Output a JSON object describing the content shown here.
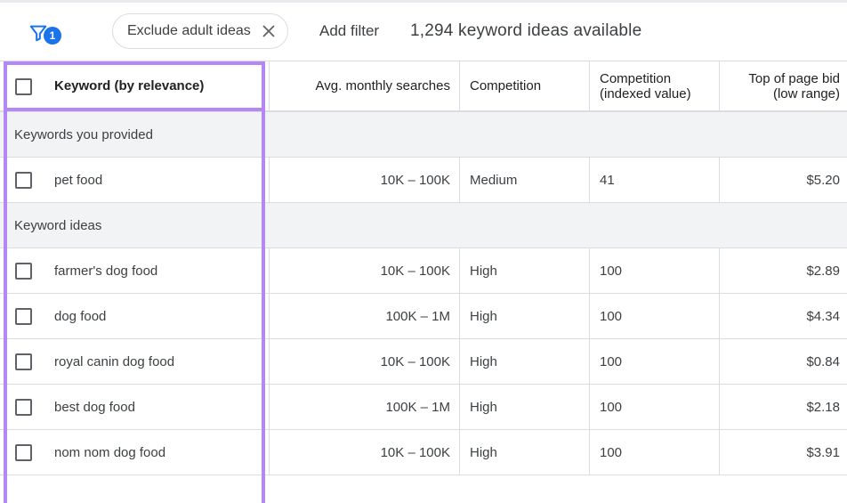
{
  "toolbar": {
    "filter_count": "1",
    "chip_label": "Exclude adult ideas",
    "add_filter": "Add filter",
    "ideas_count": "1,294 keyword ideas available"
  },
  "table": {
    "headers": {
      "keyword": "Keyword (by relevance)",
      "avg": "Avg. monthly searches",
      "competition": "Competition",
      "indexed_line1": "Competition",
      "indexed_line2": "(indexed value)",
      "bid_line1": "Top of page bid",
      "bid_line2": "(low range)"
    },
    "groups": {
      "provided": "Keywords you provided",
      "ideas": "Keyword ideas"
    },
    "provided_rows": [
      {
        "keyword": "pet food",
        "avg": "10K – 100K",
        "competition": "Medium",
        "indexed": "41",
        "bid": "$5.20"
      }
    ],
    "idea_rows": [
      {
        "keyword": "farmer's dog food",
        "avg": "10K – 100K",
        "competition": "High",
        "indexed": "100",
        "bid": "$2.89"
      },
      {
        "keyword": "dog food",
        "avg": "100K – 1M",
        "competition": "High",
        "indexed": "100",
        "bid": "$4.34"
      },
      {
        "keyword": "royal canin dog food",
        "avg": "10K – 100K",
        "competition": "High",
        "indexed": "100",
        "bid": "$0.84"
      },
      {
        "keyword": "best dog food",
        "avg": "100K – 1M",
        "competition": "High",
        "indexed": "100",
        "bid": "$2.18"
      },
      {
        "keyword": "nom nom dog food",
        "avg": "10K – 100K",
        "competition": "High",
        "indexed": "100",
        "bid": "$3.91"
      }
    ]
  },
  "colors": {
    "highlight": "#b388f5",
    "accent": "#1a73e8"
  },
  "icons": [
    "filter-icon",
    "close-icon",
    "checkbox"
  ]
}
